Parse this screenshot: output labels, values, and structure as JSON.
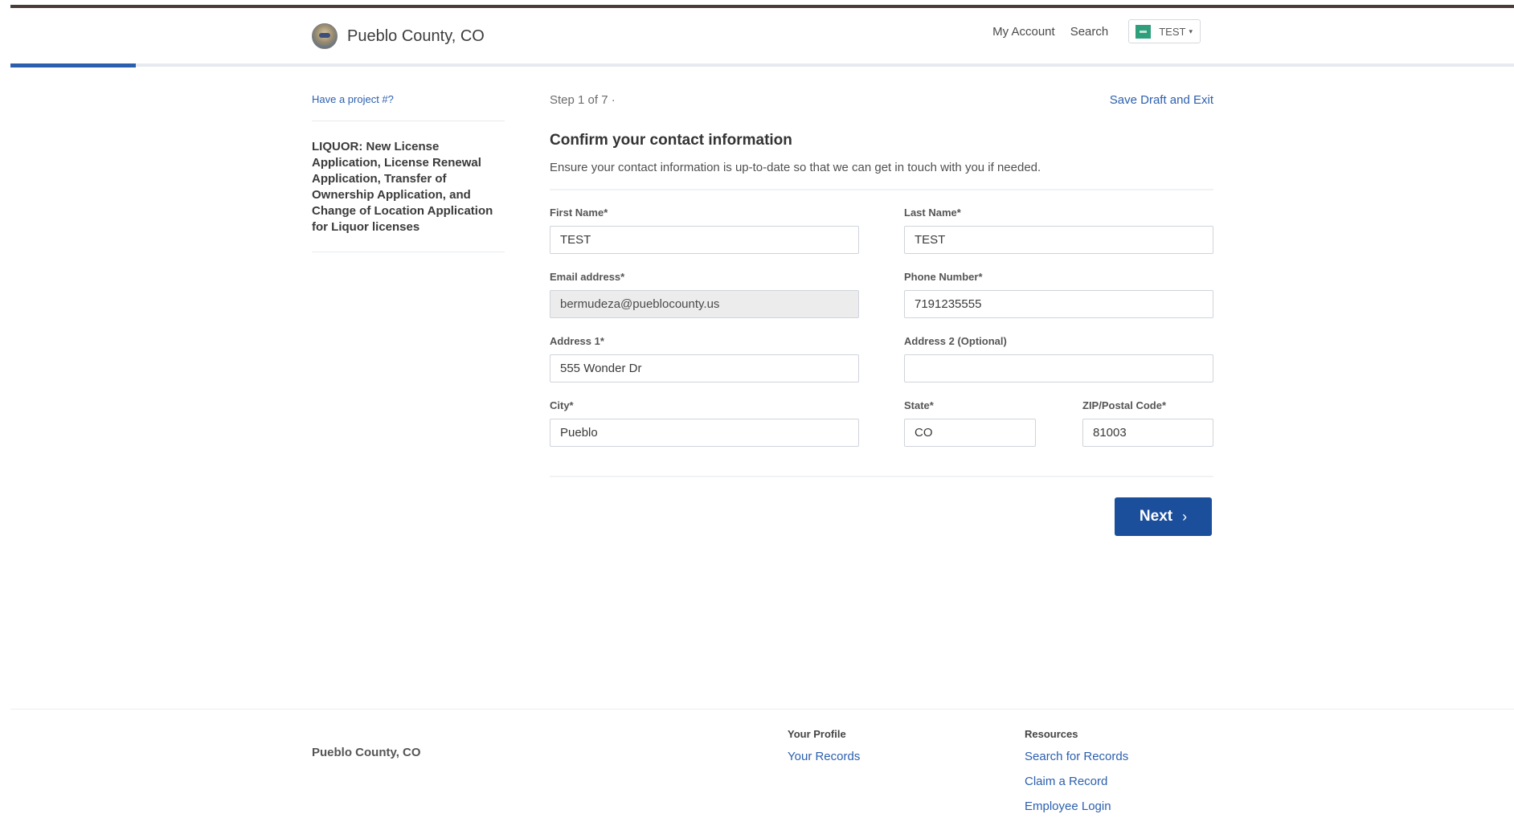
{
  "header": {
    "brand_name": "Pueblo County, CO",
    "nav": {
      "my_account": "My Account",
      "search": "Search"
    },
    "user": {
      "name": "TEST",
      "caret": "▾"
    }
  },
  "progress": {
    "current_step": 1,
    "total_steps": 7,
    "fraction": 0.0833
  },
  "sidebar": {
    "project_link": "Have a project #?",
    "application_title": "LIQUOR: New License Application, License Renewal Application, Transfer of Ownership Application, and Change of Location Application for Liquor licenses"
  },
  "main": {
    "step_text": "Step 1 of 7 ·",
    "save_draft": "Save Draft and Exit",
    "title": "Confirm your contact information",
    "description": "Ensure your contact information is up-to-date so that we can get in touch with you if needed.",
    "fields": {
      "first_name": {
        "label": "First Name*",
        "value": "TEST"
      },
      "last_name": {
        "label": "Last Name*",
        "value": "TEST"
      },
      "email": {
        "label": "Email address*",
        "value": "bermudeza@pueblocounty.us"
      },
      "phone": {
        "label": "Phone Number*",
        "value": "7191235555"
      },
      "address1": {
        "label": "Address 1*",
        "value": "555 Wonder Dr"
      },
      "address2": {
        "label": "Address 2 (Optional)",
        "value": ""
      },
      "city": {
        "label": "City*",
        "value": "Pueblo"
      },
      "state": {
        "label": "State*",
        "value": "CO"
      },
      "zip": {
        "label": "ZIP/Postal Code*",
        "value": "81003"
      }
    },
    "next_button": "Next",
    "next_chevron": "›"
  },
  "footer": {
    "brand": "Pueblo County, CO",
    "profile": {
      "heading": "Your Profile",
      "links": [
        "Your Records"
      ]
    },
    "resources": {
      "heading": "Resources",
      "links": [
        "Search for Records",
        "Claim a Record",
        "Employee Login"
      ]
    }
  },
  "colors": {
    "accent": "#2b5fae",
    "button": "#1b4f9c",
    "avatar": "#2e9e7b"
  }
}
